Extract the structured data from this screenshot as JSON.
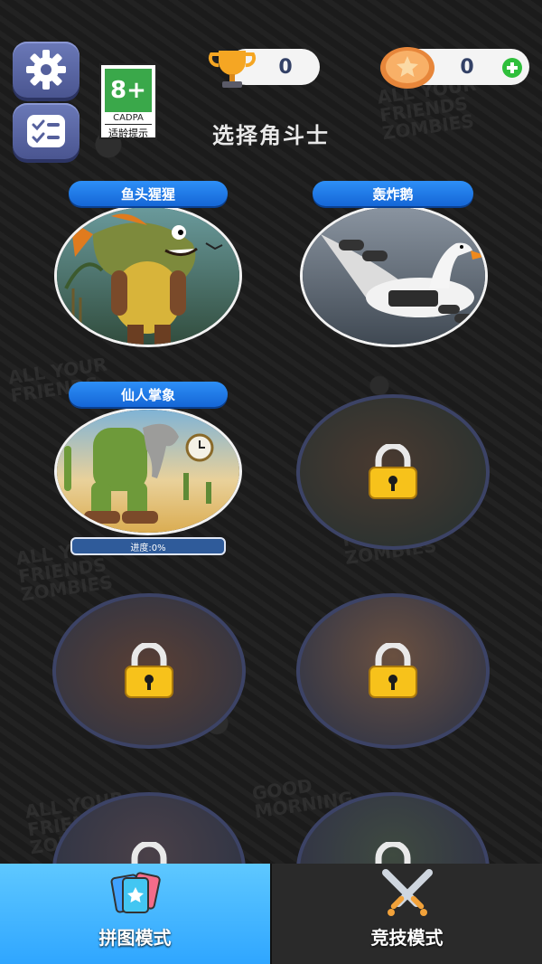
{
  "header": {
    "trophy_count": "0",
    "coin_count": "0",
    "age_rating": {
      "value": "8+",
      "org": "CADPA",
      "tip": "适龄提示"
    }
  },
  "title": "选择角斗士",
  "fighters": [
    {
      "name": "鱼头猩猩",
      "locked": false
    },
    {
      "name": "轰炸鹅",
      "locked": false
    },
    {
      "name": "仙人掌象",
      "locked": false,
      "progress_label": "进度:0%"
    },
    {
      "name": "",
      "locked": true
    },
    {
      "name": "",
      "locked": true
    },
    {
      "name": "",
      "locked": true
    },
    {
      "name": "",
      "locked": true
    },
    {
      "name": "",
      "locked": true
    }
  ],
  "tabs": [
    {
      "label": "拼图模式",
      "active": true
    },
    {
      "label": "竞技模式",
      "active": false
    }
  ],
  "colors": {
    "accent_blue": "#1e7cf0",
    "tab_active": "#3eb4ff",
    "coin": "#f29a3a",
    "trophy": "#f5a623",
    "lock": "#f7c21b"
  }
}
